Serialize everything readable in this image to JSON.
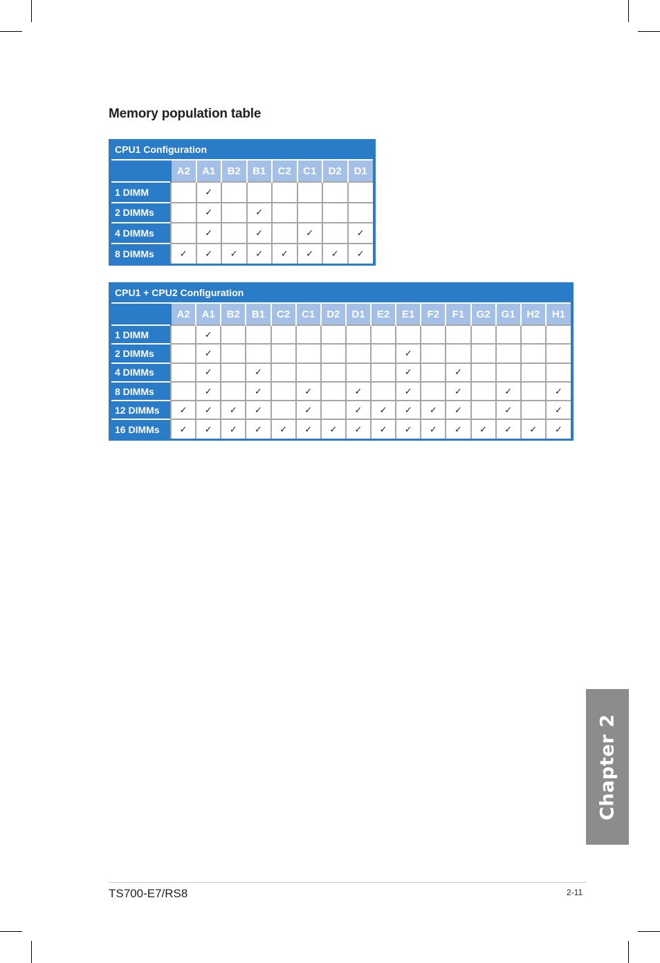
{
  "section_title": "Memory population table",
  "check_glyph": "✓",
  "colors": {
    "table_blue": "#2a7bc8",
    "header_light_blue": "#a4c0e6",
    "grid_gray": "#a6a6a6",
    "chapter_tab_gray": "#8c8c8c"
  },
  "tables": [
    {
      "caption": "CPU1 Configuration",
      "slots": [
        "A2",
        "A1",
        "B2",
        "B1",
        "C2",
        "C1",
        "D2",
        "D1"
      ],
      "rows": [
        {
          "label": "1 DIMM",
          "populated": [
            "A1"
          ]
        },
        {
          "label": "2 DIMMs",
          "populated": [
            "A1",
            "B1"
          ]
        },
        {
          "label": "4 DIMMs",
          "populated": [
            "A1",
            "B1",
            "C1",
            "D1"
          ]
        },
        {
          "label": "8 DIMMs",
          "populated": [
            "A2",
            "A1",
            "B2",
            "B1",
            "C2",
            "C1",
            "D2",
            "D1"
          ]
        }
      ]
    },
    {
      "caption": "CPU1 + CPU2 Configuration",
      "slots": [
        "A2",
        "A1",
        "B2",
        "B1",
        "C2",
        "C1",
        "D2",
        "D1",
        "E2",
        "E1",
        "F2",
        "F1",
        "G2",
        "G1",
        "H2",
        "H1"
      ],
      "rows": [
        {
          "label": "1 DIMM",
          "populated": [
            "A1"
          ]
        },
        {
          "label": "2 DIMMs",
          "populated": [
            "A1",
            "E1"
          ]
        },
        {
          "label": "4 DIMMs",
          "populated": [
            "A1",
            "B1",
            "E1",
            "F1"
          ]
        },
        {
          "label": "8 DIMMs",
          "populated": [
            "A1",
            "B1",
            "C1",
            "D1",
            "E1",
            "F1",
            "G1",
            "H1"
          ]
        },
        {
          "label": "12 DIMMs",
          "populated": [
            "A2",
            "A1",
            "B2",
            "B1",
            "C1",
            "D1",
            "E2",
            "E1",
            "F2",
            "F1",
            "G1",
            "H1"
          ]
        },
        {
          "label": "16 DIMMs",
          "populated": [
            "A2",
            "A1",
            "B2",
            "B1",
            "C2",
            "C1",
            "D2",
            "D1",
            "E2",
            "E1",
            "F2",
            "F1",
            "G2",
            "G1",
            "H2",
            "H1"
          ]
        }
      ]
    }
  ],
  "chapter_tab": "Chapter 2",
  "footer": {
    "product": "TS700-E7/RS8",
    "page_number": "2-11"
  }
}
